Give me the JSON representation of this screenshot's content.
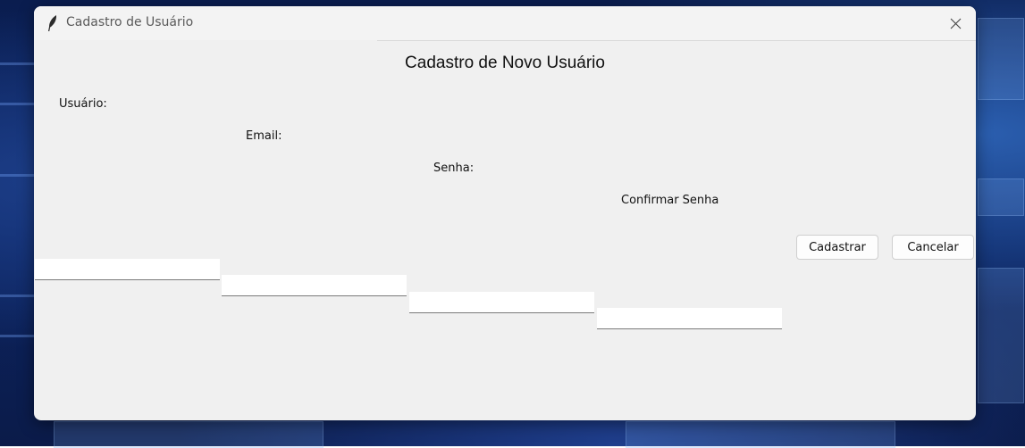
{
  "window": {
    "title": "Cadastro de Usuário",
    "app_icon": "feather-icon",
    "close_icon": "close-icon"
  },
  "form": {
    "heading": "Cadastro de Novo Usuário",
    "fields": {
      "usuario": {
        "label": "Usuário:",
        "value": ""
      },
      "email": {
        "label": "Email:",
        "value": ""
      },
      "senha": {
        "label": "Senha:",
        "value": ""
      },
      "confirmar_senha": {
        "label": "Confirmar Senha:",
        "value": ""
      }
    },
    "buttons": {
      "cadastrar": "Cadastrar",
      "cancelar": "Cancelar"
    }
  }
}
